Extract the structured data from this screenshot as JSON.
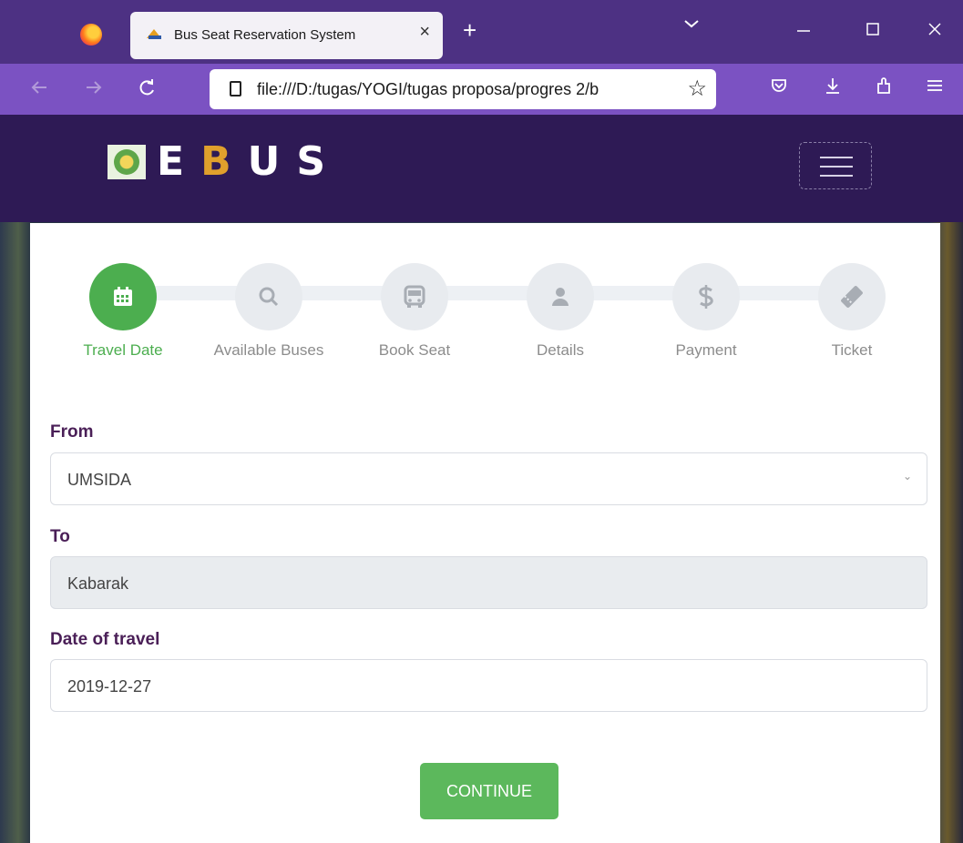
{
  "browser": {
    "tab_title": "Bus Seat Reservation System",
    "tab_close": "×",
    "new_tab": "+",
    "url": "file:///D:/tugas/YOGI/tugas proposa/progres 2/b",
    "icons": [
      "firefox-logo",
      "back-arrow",
      "forward-arrow",
      "reload",
      "page",
      "star",
      "pocket",
      "download",
      "extensions",
      "menu"
    ]
  },
  "site": {
    "logo_letters": [
      "E",
      "B",
      "U",
      "S"
    ],
    "accent_color": "#e0a02c",
    "header_bg": "#2e1a55"
  },
  "stepper": {
    "active_color": "#4cae4f",
    "steps": [
      {
        "label": "Travel Date",
        "icon": "calendar-icon",
        "active": true
      },
      {
        "label": "Available Buses",
        "icon": "search-icon",
        "active": false
      },
      {
        "label": "Book Seat",
        "icon": "bus-icon",
        "active": false
      },
      {
        "label": "Details",
        "icon": "user-icon",
        "active": false
      },
      {
        "label": "Payment",
        "icon": "dollar-icon",
        "active": false
      },
      {
        "label": "Ticket",
        "icon": "ticket-icon",
        "active": false
      }
    ]
  },
  "form": {
    "from_label": "From",
    "from_value": "UMSIDA",
    "to_label": "To",
    "to_value": "Kabarak",
    "date_label": "Date of travel",
    "date_value": "2019-12-27",
    "continue_label": "CONTINUE"
  }
}
